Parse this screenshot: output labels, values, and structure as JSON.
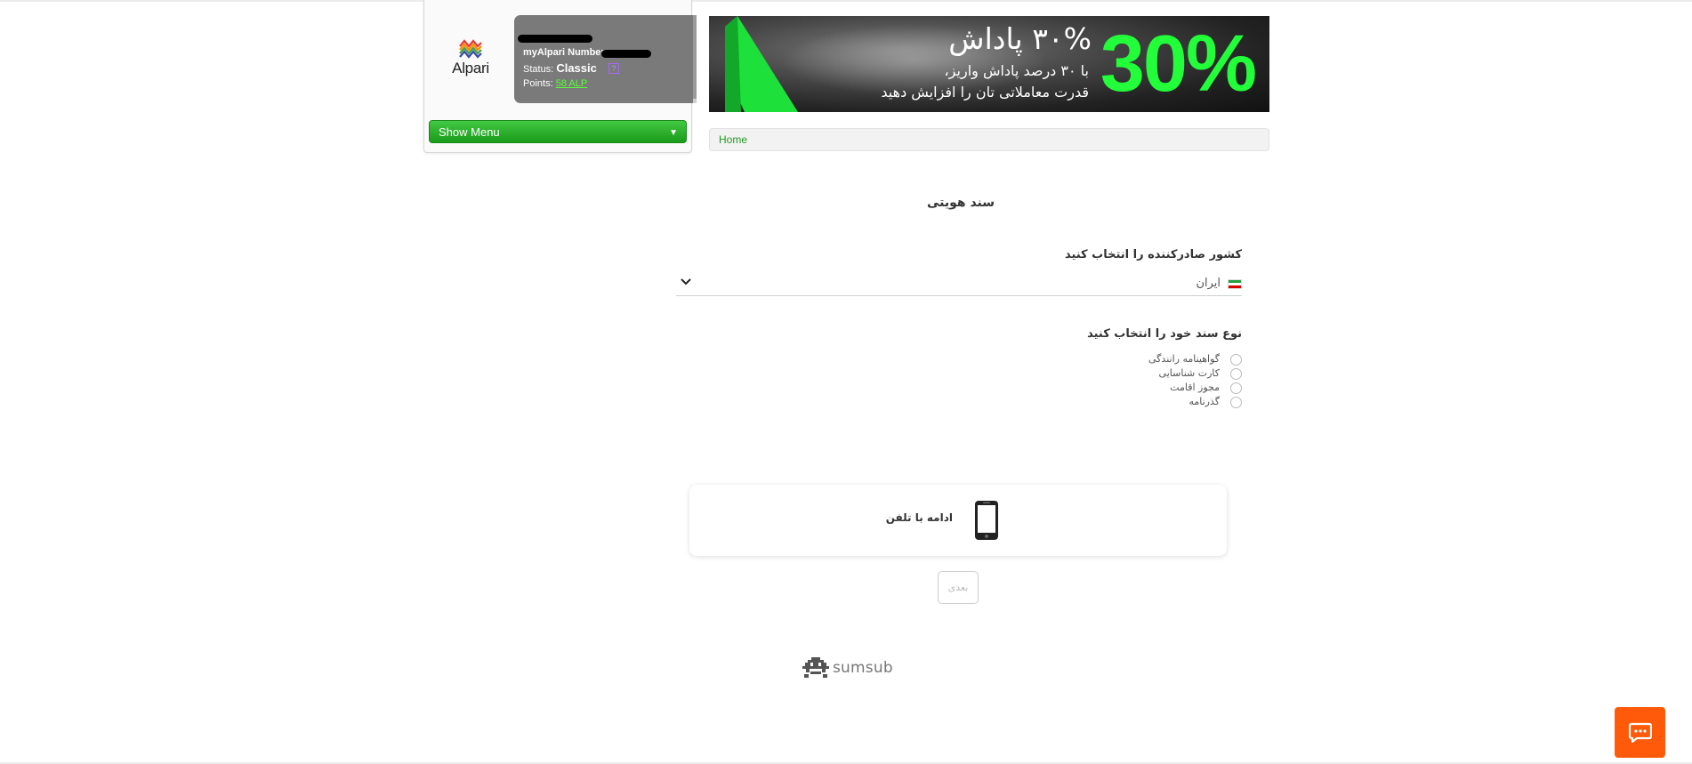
{
  "brand": {
    "name": "Alpari"
  },
  "account": {
    "number_label": "myAlpari Number:",
    "status_label": "Status:",
    "status_value": "Classic",
    "help_symbol": "?",
    "points_label": "Points:",
    "points_value": "58 ALP"
  },
  "menu": {
    "show_menu_label": "Show Menu",
    "arrow": "▼"
  },
  "banner": {
    "percent": "30%",
    "headline": "۳۰% پاداش",
    "line1": "با ۳۰ درصد پاداش واریز،",
    "line2": "قدرت معاملاتی تان را افزایش دهید"
  },
  "breadcrumb": {
    "home": "Home"
  },
  "form": {
    "title": "سند هویتی",
    "country_label": "کشور صادرکننده را انتخاب کنید",
    "country_value": "ایران",
    "doc_type_label": "نوع سند خود را انتخاب کنید",
    "doc_types": [
      {
        "label": "گواهینامه رانندگی"
      },
      {
        "label": "کارت شناسایی"
      },
      {
        "label": "مجوز اقامت"
      },
      {
        "label": "گذرنامه"
      }
    ],
    "phone_continue": "ادامه با تلفن",
    "next_label": "بعدی"
  },
  "footer": {
    "provider": "sumsub"
  },
  "colors": {
    "accent_green": "#1a9a1a",
    "chat_orange": "#ff5a0a",
    "banner_green": "#22ff3a"
  }
}
